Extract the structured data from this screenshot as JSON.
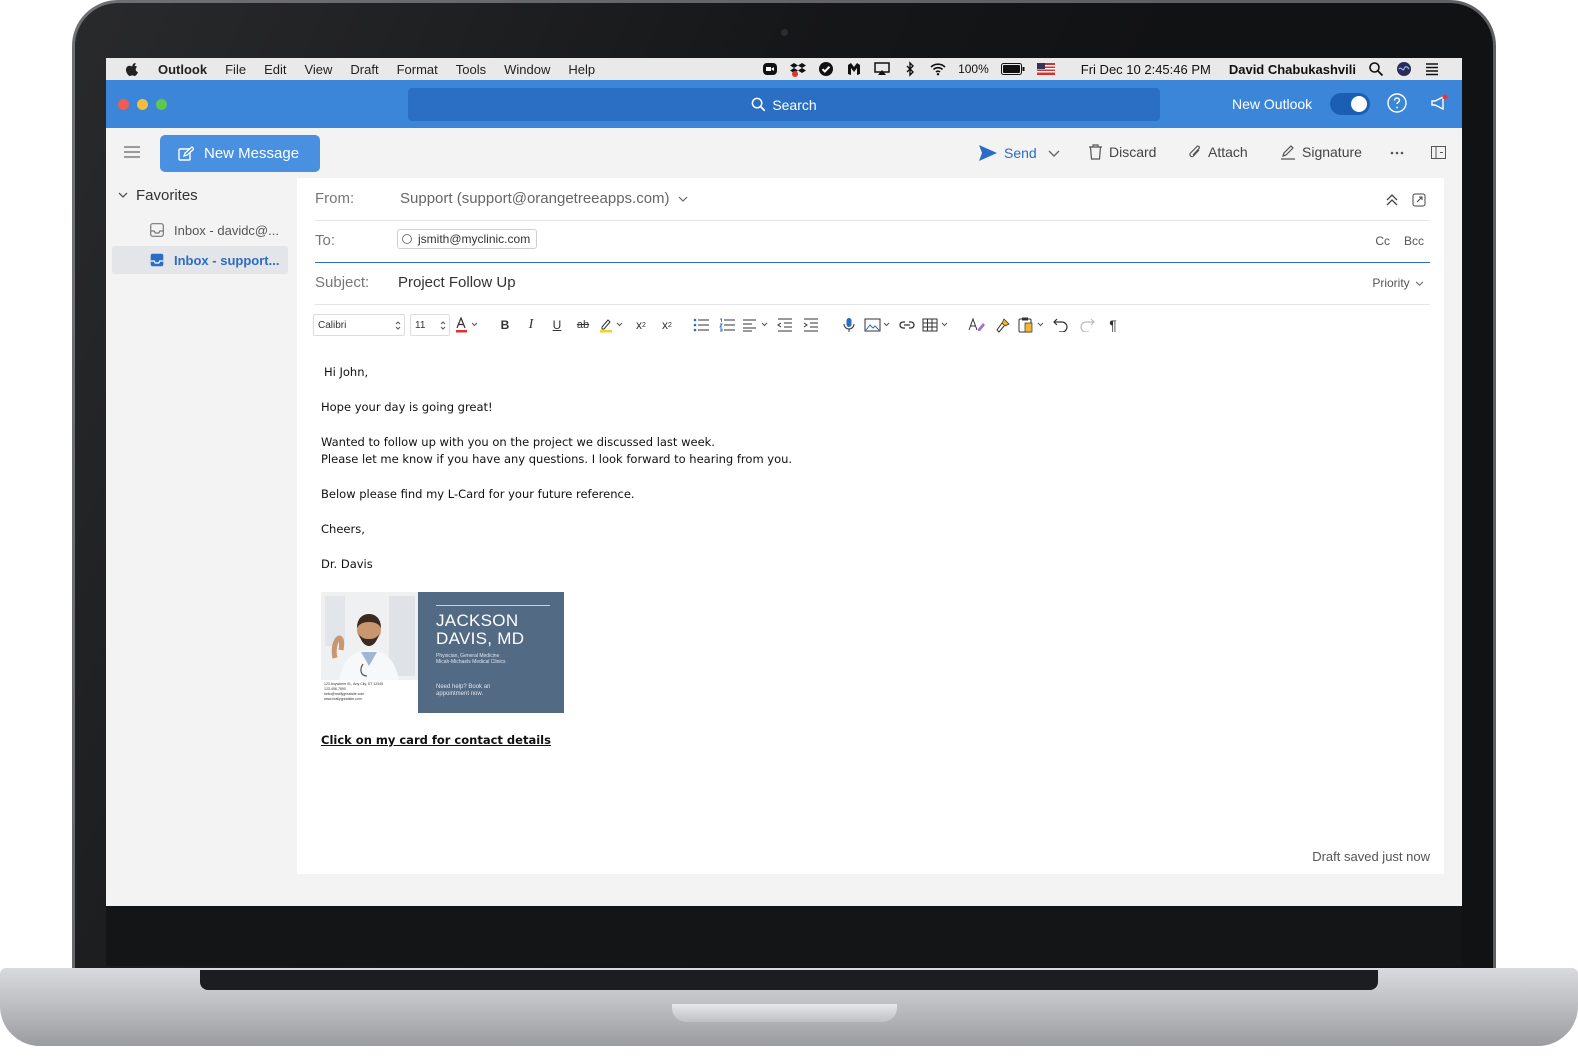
{
  "menubar": {
    "app_name": "Outlook",
    "items": [
      "File",
      "Edit",
      "View",
      "Draft",
      "Format",
      "Tools",
      "Window",
      "Help"
    ],
    "battery": "100%",
    "datetime": "Fri Dec 10  2:45:46 PM",
    "user": "David Chabukashvili"
  },
  "titlebar": {
    "search_label": "Search",
    "new_outlook_label": "New Outlook",
    "toggle_on": true
  },
  "toolbar": {
    "new_message_label": "New Message",
    "send_label": "Send",
    "discard_label": "Discard",
    "attach_label": "Attach",
    "signature_label": "Signature"
  },
  "sidebar": {
    "favorites_label": "Favorites",
    "items": [
      {
        "label": "Inbox - davidc@..."
      },
      {
        "label": "Inbox - support..."
      }
    ]
  },
  "compose": {
    "from_label": "From:",
    "from_value": "Support (support@orangetreeapps.com)",
    "to_label": "To:",
    "to_recipient": "jsmith@myclinic.com",
    "cc_label": "Cc",
    "bcc_label": "Bcc",
    "subject_label": "Subject:",
    "subject_value": "Project Follow Up",
    "priority_label": "Priority",
    "font_name": "Calibri",
    "font_size": "11",
    "body": {
      "greeting": "Hi John,",
      "line1": "Hope your day is going great!",
      "line2": "Wanted to follow up with you on the project we discussed last week.",
      "line3": "Please let me know if you have any questions. I look forward to hearing from you.",
      "line4": "Below please find my L-Card for your future reference.",
      "signoff": "Cheers,",
      "signature": "Dr. Davis"
    },
    "card": {
      "name_line1": "JACKSON",
      "name_line2": "DAVIS, MD",
      "title_line1": "Physician, General Medicine",
      "title_line2": "Micah-Michaels Medical Clinics",
      "cta_line1": "Need help? Book an",
      "cta_line2": "appointment now.",
      "address": "123 Anywhere St., Any City, ST 12345",
      "phone": "123-456-7890",
      "email": "hello@reallygreatsite.com",
      "web": "www.reallygreatsite.com"
    },
    "card_link": "Click on my card for contact details",
    "draft_status": "Draft saved just now"
  },
  "colors": {
    "titlebar": "#3b86d8",
    "accent": "#2b6cc4",
    "card_bg": "#536a85"
  }
}
